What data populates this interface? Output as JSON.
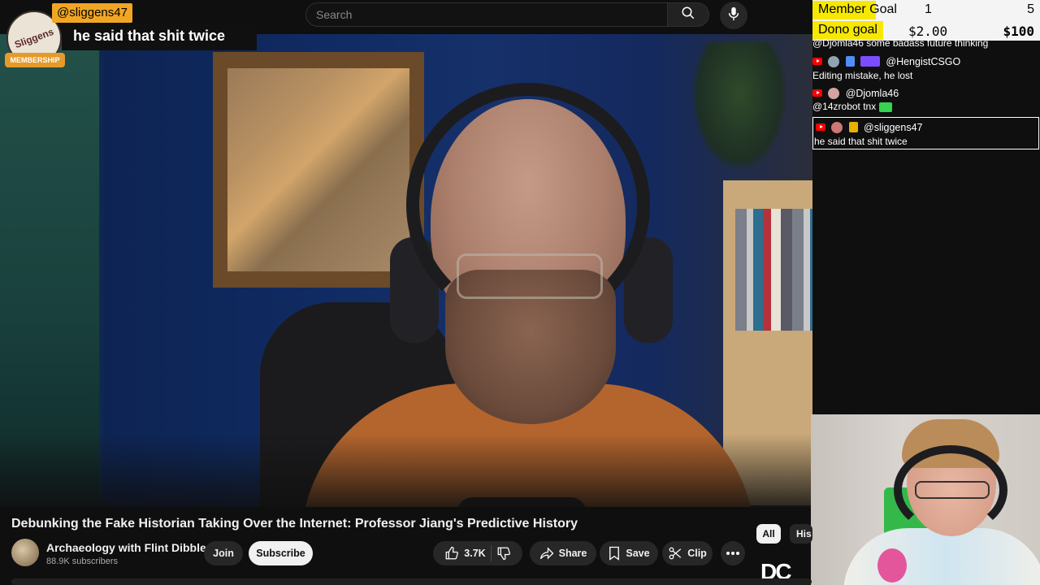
{
  "search": {
    "placeholder": "Search"
  },
  "membership": {
    "username": "@sliggens47",
    "message": "he said that shit twice",
    "badge": "MEMBERSHIP",
    "avatar_text": "Sliggens"
  },
  "goals": [
    {
      "label": "Member Goal",
      "current": "1",
      "target": "5",
      "progress": 0.2
    },
    {
      "label": "Dono goal",
      "current": "$2.00",
      "target": "$100",
      "progress": 0.02
    }
  ],
  "goal_colors": {
    "fill": "#f6e800",
    "background": "#f4f4f4"
  },
  "chat": [
    {
      "text": "@Djomla46 some badass future thinking"
    },
    {
      "name": "@HengistCSGO",
      "text": "Editing mistake, he lost"
    },
    {
      "name": "@Djomla46",
      "text": "@14zrobot tnx"
    },
    {
      "name": "@sliggens47",
      "text": "he said that shit twice",
      "highlighted": true
    }
  ],
  "video": {
    "title": "Debunking the Fake Historian Taking Over the Internet: Professor Jiang's Predictive History"
  },
  "channel": {
    "name": "Archaeology with Flint Dibble",
    "subscribers": "88.9K subscribers"
  },
  "actions": {
    "join": "Join",
    "subscribe": "Subscribe",
    "likes": "3.7K",
    "share": "Share",
    "save": "Save",
    "clip": "Clip"
  },
  "chips": [
    "All",
    "His"
  ],
  "side_logo": "DC",
  "icons": [
    "search-icon",
    "mic-icon",
    "like-icon",
    "dislike-icon",
    "share-icon",
    "save-icon",
    "clip-icon",
    "more-icon",
    "youtube-icon"
  ]
}
